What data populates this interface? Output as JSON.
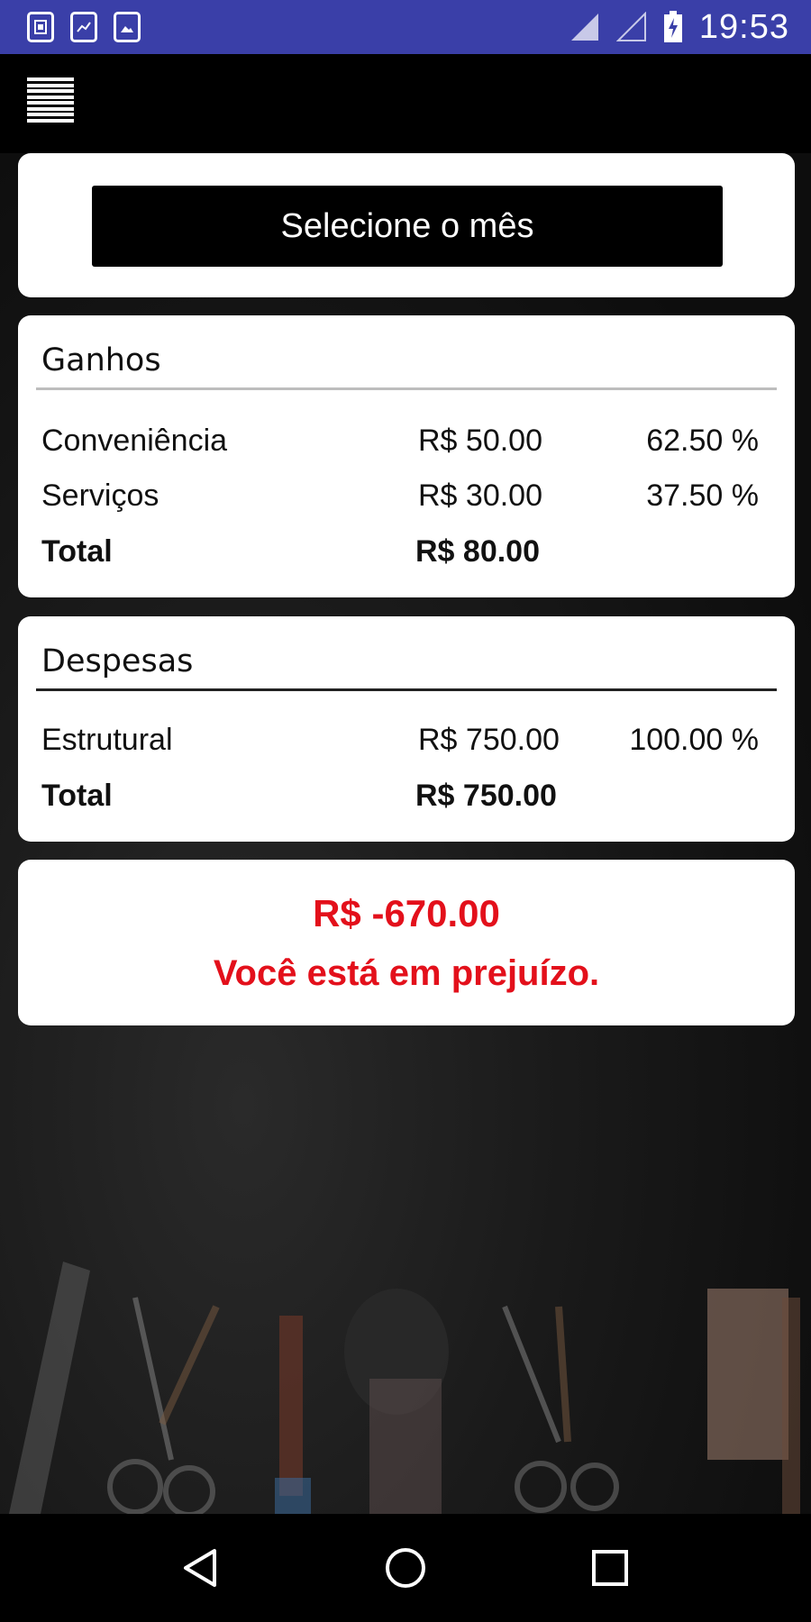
{
  "status_bar": {
    "time": "19:53",
    "left_icons": [
      "sim-notification-icon",
      "chart-notification-icon",
      "image-notification-icon"
    ],
    "right_icons": [
      "signal-icon",
      "signal-empty-icon",
      "battery-charging-icon"
    ],
    "color": "#3a3fa8"
  },
  "month_selector": {
    "label": "Selecione o mês"
  },
  "ganhos": {
    "title": "Ganhos",
    "rows": [
      {
        "name": "Conveniência",
        "value": "R$ 50.00",
        "percent": "62.50 %"
      },
      {
        "name": "Serviços",
        "value": "R$ 30.00",
        "percent": "37.50 %"
      }
    ],
    "total_label": "Total",
    "total_value": "R$ 80.00"
  },
  "despesas": {
    "title": "Despesas",
    "rows": [
      {
        "name": "Estrutural",
        "value": "R$ 750.00",
        "percent": "100.00 %"
      }
    ],
    "total_label": "Total",
    "total_value": "R$ 750.00"
  },
  "result": {
    "value": "R$ -670.00",
    "message": "Você está em prejuízo.",
    "color": "#e3101b"
  },
  "nav_bar": {
    "icons": [
      "back-icon",
      "home-icon",
      "recents-icon"
    ]
  }
}
